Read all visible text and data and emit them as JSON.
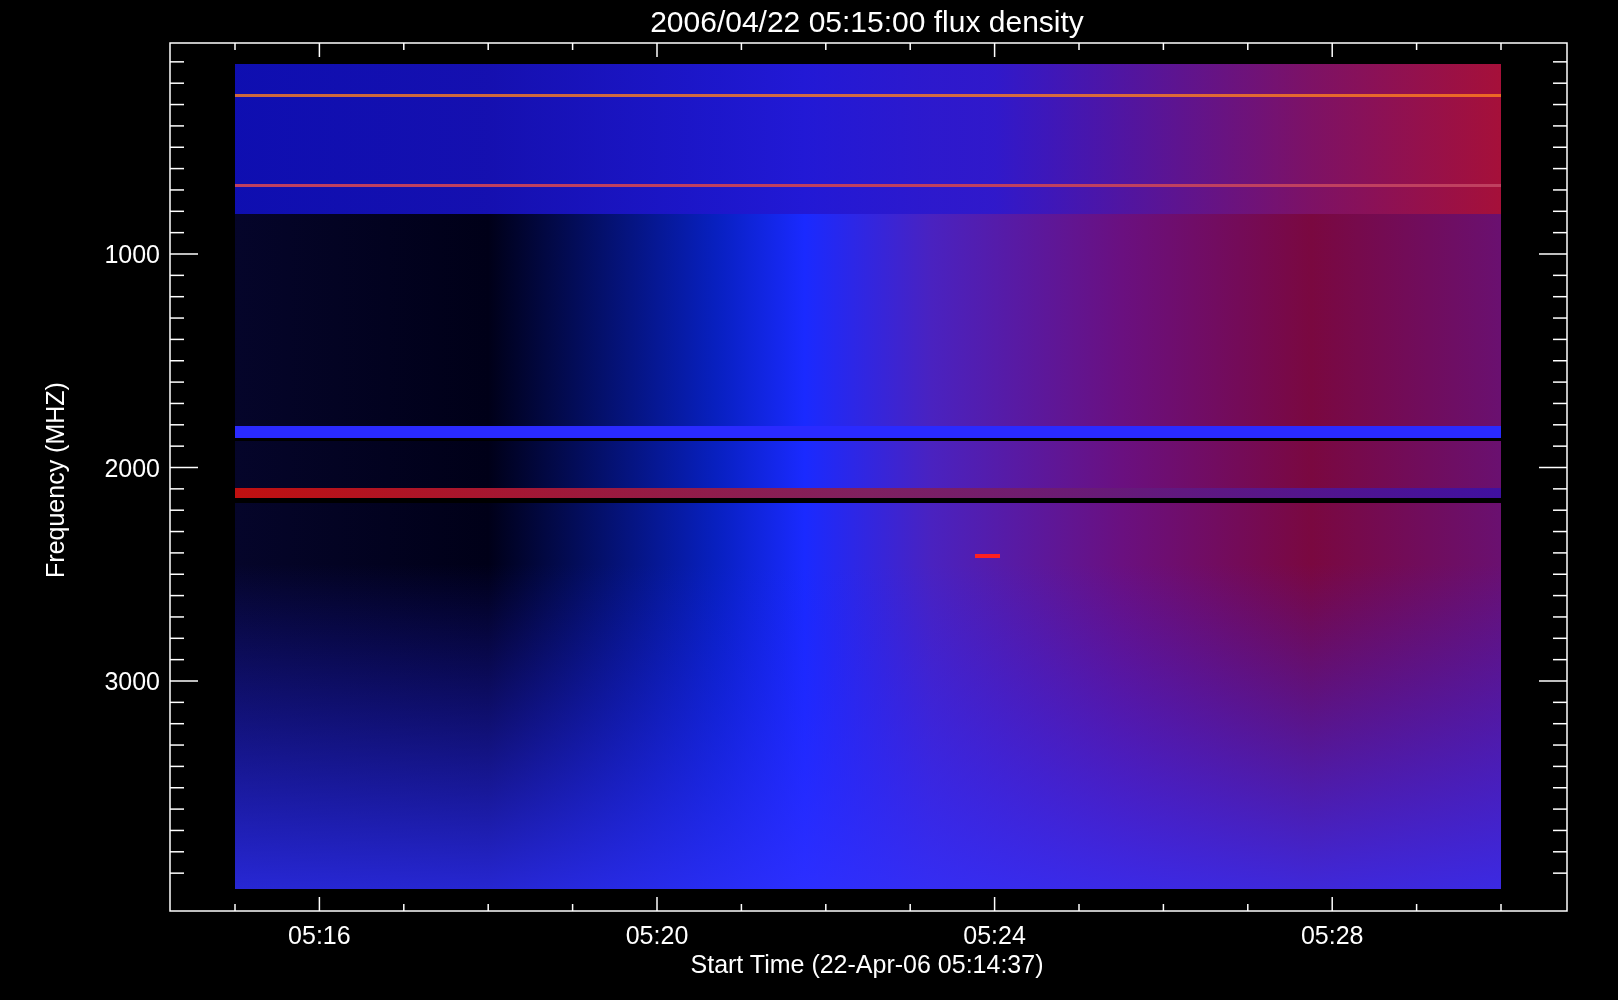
{
  "title": "2006/04/22 05:15:00 flux density",
  "x_axis": {
    "label": "Start Time (22-Apr-06 05:14:37)",
    "ticks": [
      "05:16",
      "05:20",
      "05:24",
      "05:28"
    ]
  },
  "y_axis": {
    "label": "Frequency (MHZ)",
    "ticks": [
      "1000",
      "2000",
      "3000"
    ]
  }
}
